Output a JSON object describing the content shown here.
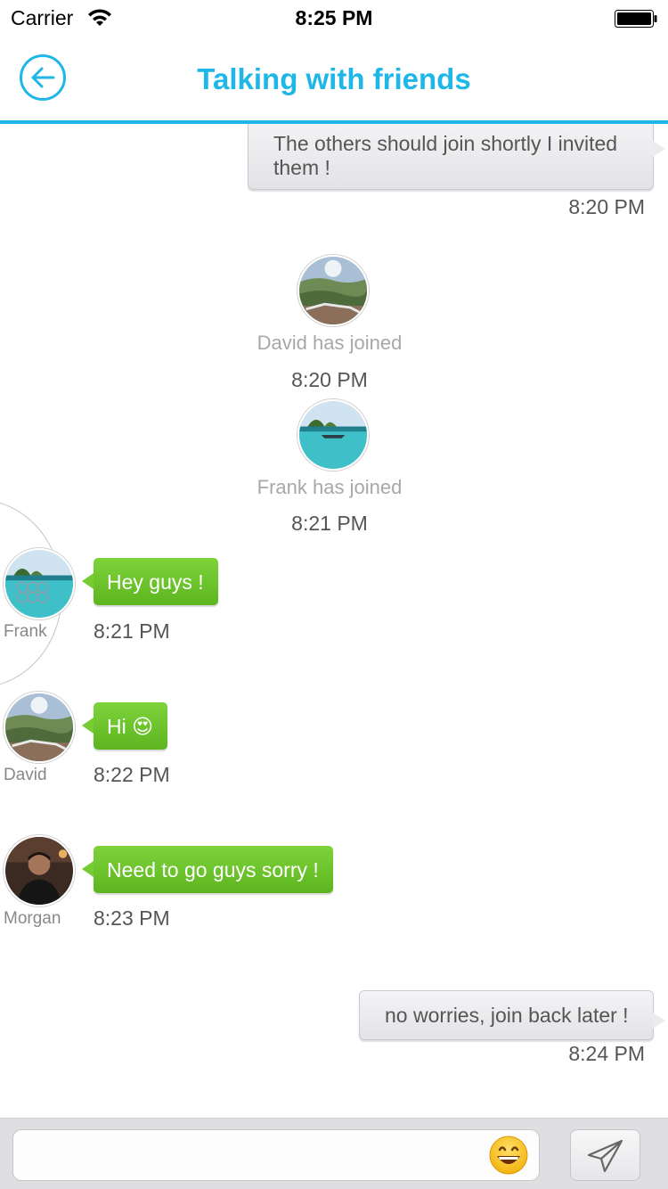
{
  "status_bar": {
    "carrier": "Carrier",
    "time": "8:25 PM"
  },
  "nav": {
    "title": "Talking with friends"
  },
  "messages": [
    {
      "type": "outgoing",
      "text": "The others should join shortly I invited them !",
      "time": "8:20 PM"
    },
    {
      "type": "join",
      "text": "David has joined",
      "time": "8:20 PM"
    },
    {
      "type": "join",
      "text": "Frank has joined",
      "time": "8:21 PM"
    },
    {
      "type": "incoming",
      "sender": "Frank",
      "text": "Hey guys !",
      "time": "8:21 PM"
    },
    {
      "type": "incoming",
      "sender": "David",
      "text": "Hi 😍",
      "time": "8:22 PM"
    },
    {
      "type": "incoming",
      "sender": "Morgan",
      "text": "Need to go guys sorry !",
      "time": "8:23 PM"
    },
    {
      "type": "outgoing",
      "text": "no worries, join back later !",
      "time": "8:24 PM"
    }
  ],
  "input": {
    "value": "",
    "placeholder": ""
  },
  "colors": {
    "accent": "#1fb7e8",
    "incoming_bubble": "#6cc52c",
    "outgoing_bubble": "#e8e8eb"
  }
}
